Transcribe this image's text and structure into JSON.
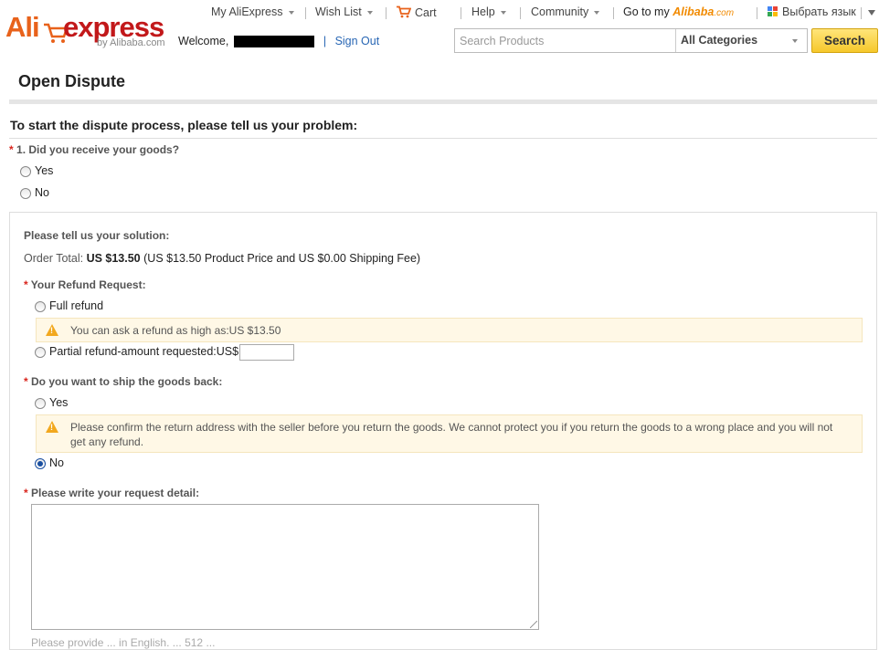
{
  "header": {
    "logo": {
      "brand_left": "Ali",
      "brand_right": "express",
      "byline": "by Alibaba.com"
    },
    "nav": {
      "my_aliexpress": "My AliExpress",
      "wish_list": "Wish List",
      "cart": "Cart",
      "help": "Help",
      "community": "Community",
      "go_to_my": "Go to my",
      "alibaba": "Alibaba",
      "alibaba_suffix": ".com",
      "language": "Выбрать язык"
    },
    "welcome": "Welcome,",
    "sign_out": "Sign Out",
    "search": {
      "placeholder": "Search Products",
      "category": "All Categories",
      "button": "Search"
    }
  },
  "page": {
    "title": "Open Dispute",
    "problem_heading": "To start the dispute process, please tell us your problem:",
    "q1": {
      "asterisk": "*",
      "label": "1. Did you receive your goods?",
      "options": [
        "Yes",
        "No"
      ]
    },
    "solution": {
      "heading": "Please tell us your solution:",
      "order_total_label": "Order Total:",
      "order_total_amount": "US $13.50",
      "order_total_detail": "(US $13.50 Product Price and US $0.00 Shipping Fee)",
      "refund_label": "Your Refund Request:",
      "full_refund": "Full refund",
      "refund_warning": "You can ask a refund as high as:US $13.50",
      "partial_refund": "Partial refund-amount requested:US$",
      "ship_label": "Do you want to ship the goods back:",
      "ship_yes": "Yes",
      "ship_warning": "Please confirm the return address with the seller before you return the goods. We cannot protect you if you return the goods to a wrong place and you will not get any refund.",
      "ship_no": "No",
      "detail_label": "Please write your request detail:",
      "detail_hint": "Please provide ... in English. ... 512 ..."
    }
  },
  "colors": {
    "brand_orange": "#e8621b",
    "brand_red": "#c2181a",
    "link_blue": "#2866b4",
    "required_red": "#d9251d",
    "warning_bg": "#fff8e6",
    "warning_icon": "#f2a81e",
    "search_button": "#f6c82b"
  }
}
